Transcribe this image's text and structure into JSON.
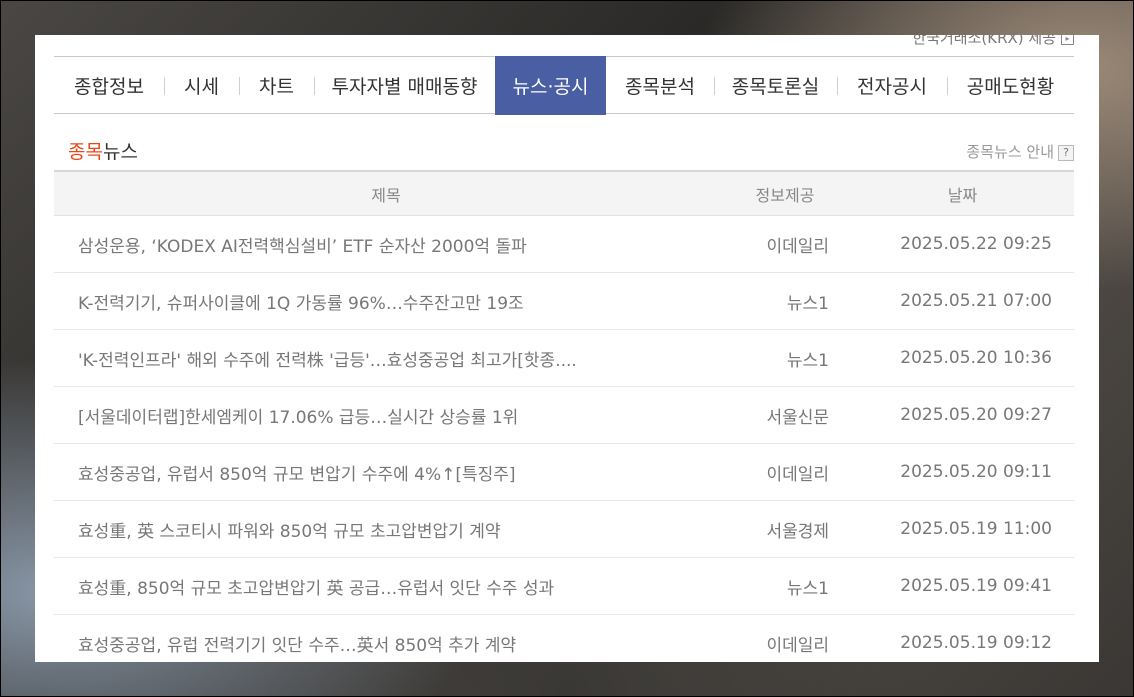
{
  "provider": {
    "text": "한국거래소(KRX) 제공"
  },
  "tabs": [
    {
      "label": "종합정보"
    },
    {
      "label": "시세"
    },
    {
      "label": "차트"
    },
    {
      "label": "투자자별 매매동향"
    },
    {
      "label": "뉴스·공시",
      "active": true
    },
    {
      "label": "종목분석"
    },
    {
      "label": "종목토론실"
    },
    {
      "label": "전자공시"
    },
    {
      "label": "공매도현황"
    }
  ],
  "section": {
    "accent": "종목",
    "rest": "뉴스",
    "guide": "종목뉴스 안내",
    "guide_icon": "?"
  },
  "table": {
    "headers": {
      "title": "제목",
      "source": "정보제공",
      "date": "날짜"
    },
    "rows": [
      {
        "title": "삼성운용, ‘KODEX AI전력핵심설비’ ETF 순자산 2000억 돌파",
        "source": "이데일리",
        "date": "2025.05.22 09:25"
      },
      {
        "title": "K-전력기기, 슈퍼사이클에 1Q 가동률 96%…수주잔고만 19조",
        "source": "뉴스1",
        "date": "2025.05.21 07:00"
      },
      {
        "title": "'K-전력인프라' 해외 수주에 전력株 '급등'…효성중공업 최고가[핫종....",
        "source": "뉴스1",
        "date": "2025.05.20 10:36"
      },
      {
        "title": "[서울데이터랩]한세엠케이 17.06% 급등…실시간 상승률 1위",
        "source": "서울신문",
        "date": "2025.05.20 09:27"
      },
      {
        "title": "효성중공업, 유럽서 850억 규모 변압기 수주에 4%↑[특징주]",
        "source": "이데일리",
        "date": "2025.05.20 09:11"
      },
      {
        "title": "효성重, 英 스코티시 파워와 850억 규모 초고압변압기 계약",
        "source": "서울경제",
        "date": "2025.05.19 11:00"
      },
      {
        "title": "효성重, 850억 규모 초고압변압기 英 공급…유럽서 잇단 수주 성과",
        "source": "뉴스1",
        "date": "2025.05.19 09:41"
      },
      {
        "title": "효성중공업, 유럽 전력기기 잇단 수주…英서 850억 추가 계약",
        "source": "이데일리",
        "date": "2025.05.19 09:12"
      }
    ]
  },
  "colors": {
    "active_tab": "#4a5fa3",
    "accent": "#e8471a"
  }
}
